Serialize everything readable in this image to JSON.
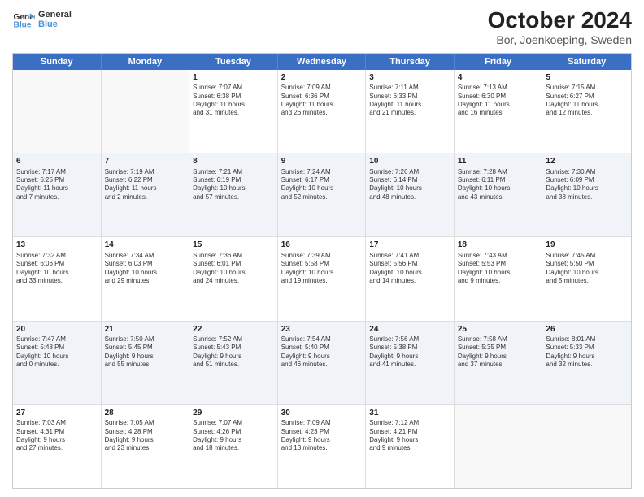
{
  "logo": {
    "text_general": "General",
    "text_blue": "Blue"
  },
  "title": {
    "main": "October 2024",
    "sub": "Bor, Joenkoeping, Sweden"
  },
  "weekdays": [
    "Sunday",
    "Monday",
    "Tuesday",
    "Wednesday",
    "Thursday",
    "Friday",
    "Saturday"
  ],
  "weeks": [
    [
      {
        "day": "",
        "content": ""
      },
      {
        "day": "",
        "content": ""
      },
      {
        "day": "1",
        "content": "Sunrise: 7:07 AM\nSunset: 6:38 PM\nDaylight: 11 hours\nand 31 minutes."
      },
      {
        "day": "2",
        "content": "Sunrise: 7:09 AM\nSunset: 6:36 PM\nDaylight: 11 hours\nand 26 minutes."
      },
      {
        "day": "3",
        "content": "Sunrise: 7:11 AM\nSunset: 6:33 PM\nDaylight: 11 hours\nand 21 minutes."
      },
      {
        "day": "4",
        "content": "Sunrise: 7:13 AM\nSunset: 6:30 PM\nDaylight: 11 hours\nand 16 minutes."
      },
      {
        "day": "5",
        "content": "Sunrise: 7:15 AM\nSunset: 6:27 PM\nDaylight: 11 hours\nand 12 minutes."
      }
    ],
    [
      {
        "day": "6",
        "content": "Sunrise: 7:17 AM\nSunset: 6:25 PM\nDaylight: 11 hours\nand 7 minutes."
      },
      {
        "day": "7",
        "content": "Sunrise: 7:19 AM\nSunset: 6:22 PM\nDaylight: 11 hours\nand 2 minutes."
      },
      {
        "day": "8",
        "content": "Sunrise: 7:21 AM\nSunset: 6:19 PM\nDaylight: 10 hours\nand 57 minutes."
      },
      {
        "day": "9",
        "content": "Sunrise: 7:24 AM\nSunset: 6:17 PM\nDaylight: 10 hours\nand 52 minutes."
      },
      {
        "day": "10",
        "content": "Sunrise: 7:26 AM\nSunset: 6:14 PM\nDaylight: 10 hours\nand 48 minutes."
      },
      {
        "day": "11",
        "content": "Sunrise: 7:28 AM\nSunset: 6:11 PM\nDaylight: 10 hours\nand 43 minutes."
      },
      {
        "day": "12",
        "content": "Sunrise: 7:30 AM\nSunset: 6:09 PM\nDaylight: 10 hours\nand 38 minutes."
      }
    ],
    [
      {
        "day": "13",
        "content": "Sunrise: 7:32 AM\nSunset: 6:06 PM\nDaylight: 10 hours\nand 33 minutes."
      },
      {
        "day": "14",
        "content": "Sunrise: 7:34 AM\nSunset: 6:03 PM\nDaylight: 10 hours\nand 29 minutes."
      },
      {
        "day": "15",
        "content": "Sunrise: 7:36 AM\nSunset: 6:01 PM\nDaylight: 10 hours\nand 24 minutes."
      },
      {
        "day": "16",
        "content": "Sunrise: 7:39 AM\nSunset: 5:58 PM\nDaylight: 10 hours\nand 19 minutes."
      },
      {
        "day": "17",
        "content": "Sunrise: 7:41 AM\nSunset: 5:56 PM\nDaylight: 10 hours\nand 14 minutes."
      },
      {
        "day": "18",
        "content": "Sunrise: 7:43 AM\nSunset: 5:53 PM\nDaylight: 10 hours\nand 9 minutes."
      },
      {
        "day": "19",
        "content": "Sunrise: 7:45 AM\nSunset: 5:50 PM\nDaylight: 10 hours\nand 5 minutes."
      }
    ],
    [
      {
        "day": "20",
        "content": "Sunrise: 7:47 AM\nSunset: 5:48 PM\nDaylight: 10 hours\nand 0 minutes."
      },
      {
        "day": "21",
        "content": "Sunrise: 7:50 AM\nSunset: 5:45 PM\nDaylight: 9 hours\nand 55 minutes."
      },
      {
        "day": "22",
        "content": "Sunrise: 7:52 AM\nSunset: 5:43 PM\nDaylight: 9 hours\nand 51 minutes."
      },
      {
        "day": "23",
        "content": "Sunrise: 7:54 AM\nSunset: 5:40 PM\nDaylight: 9 hours\nand 46 minutes."
      },
      {
        "day": "24",
        "content": "Sunrise: 7:56 AM\nSunset: 5:38 PM\nDaylight: 9 hours\nand 41 minutes."
      },
      {
        "day": "25",
        "content": "Sunrise: 7:58 AM\nSunset: 5:35 PM\nDaylight: 9 hours\nand 37 minutes."
      },
      {
        "day": "26",
        "content": "Sunrise: 8:01 AM\nSunset: 5:33 PM\nDaylight: 9 hours\nand 32 minutes."
      }
    ],
    [
      {
        "day": "27",
        "content": "Sunrise: 7:03 AM\nSunset: 4:31 PM\nDaylight: 9 hours\nand 27 minutes."
      },
      {
        "day": "28",
        "content": "Sunrise: 7:05 AM\nSunset: 4:28 PM\nDaylight: 9 hours\nand 23 minutes."
      },
      {
        "day": "29",
        "content": "Sunrise: 7:07 AM\nSunset: 4:26 PM\nDaylight: 9 hours\nand 18 minutes."
      },
      {
        "day": "30",
        "content": "Sunrise: 7:09 AM\nSunset: 4:23 PM\nDaylight: 9 hours\nand 13 minutes."
      },
      {
        "day": "31",
        "content": "Sunrise: 7:12 AM\nSunset: 4:21 PM\nDaylight: 9 hours\nand 9 minutes."
      },
      {
        "day": "",
        "content": ""
      },
      {
        "day": "",
        "content": ""
      }
    ]
  ]
}
